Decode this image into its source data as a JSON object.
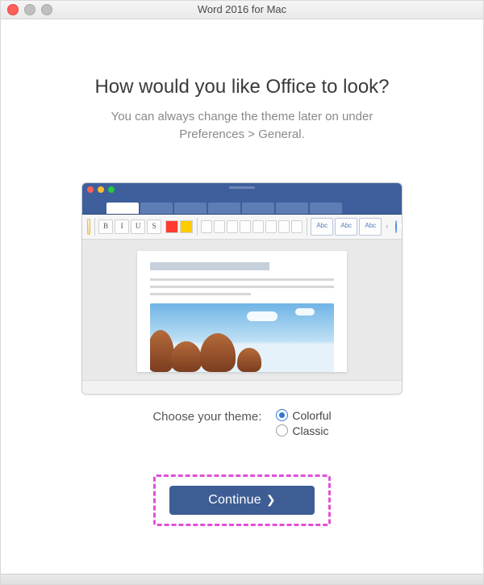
{
  "window": {
    "title": "Word 2016 for Mac"
  },
  "heading": "How would you like Office to look?",
  "subtext_line1": "You can always change the theme later on under",
  "subtext_line2": "Preferences > General.",
  "theme": {
    "prompt": "Choose your theme:",
    "options": [
      {
        "label": "Colorful",
        "selected": true
      },
      {
        "label": "Classic",
        "selected": false
      }
    ]
  },
  "preview": {
    "style_buttons": [
      "Abc",
      "Abc",
      "Abc"
    ],
    "toolbar_font_buttons": [
      "B",
      "I",
      "U",
      "S"
    ]
  },
  "continue_label": "Continue",
  "colors": {
    "accent": "#3e5d94",
    "highlight": "#e14fd8",
    "radio_selected": "#2f78d2"
  }
}
